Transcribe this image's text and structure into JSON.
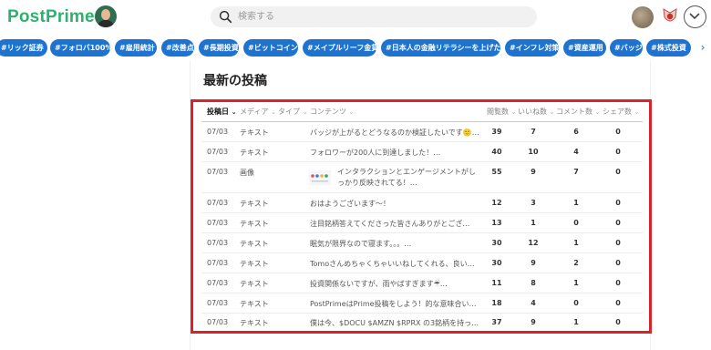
{
  "header": {
    "logo_text": "PostPrime",
    "search": {
      "placeholder": "検索する"
    }
  },
  "tags": [
    "#リック証券",
    "#フォロバ100%",
    "#雇用統計",
    "#改善点",
    "#長期投資",
    "#ビットコイン",
    "#メイプルリーフ金貨",
    "#日本人の金融リテラシーを上げたい",
    "#インフレ対策",
    "#資産運用",
    "#バッジ",
    "#株式投資"
  ],
  "main": {
    "section_title": "最新の投稿",
    "columns": {
      "date": "投稿日",
      "media": "メディア",
      "type": "タイプ",
      "contents": "コンテンツ",
      "views": "閲覧数",
      "likes": "いいね数",
      "comments": "コメント数",
      "shares": "シェア数"
    },
    "rows": [
      {
        "date": "07/03",
        "media": "テキスト",
        "content": "バッジが上がるとどうなるのか検証したいです🙂…",
        "views": "39",
        "likes": "7",
        "comments": "6",
        "shares": "0"
      },
      {
        "date": "07/03",
        "media": "テキスト",
        "content": "フォロワーが200人に到達しました！…",
        "views": "40",
        "likes": "10",
        "comments": "4",
        "shares": "0"
      },
      {
        "date": "07/03",
        "media": "画像",
        "content": "インタラクションとエンゲージメントがし",
        "content2": "っかり反映されてる！…",
        "views": "55",
        "likes": "9",
        "comments": "7",
        "shares": "0"
      },
      {
        "date": "07/03",
        "media": "テキスト",
        "content": "おはようございます〜！",
        "views": "12",
        "likes": "3",
        "comments": "1",
        "shares": "0"
      },
      {
        "date": "07/03",
        "media": "テキスト",
        "content": "注目銘柄答えてくださった皆さんありがとござ…",
        "views": "13",
        "likes": "1",
        "comments": "0",
        "shares": "0"
      },
      {
        "date": "07/03",
        "media": "テキスト",
        "content": "眠気が限界なので寝ます。。。…",
        "views": "30",
        "likes": "12",
        "comments": "1",
        "shares": "0"
      },
      {
        "date": "07/03",
        "media": "テキスト",
        "content": "Tomoさんめちゃくちゃいいねしてくれる、良い…",
        "views": "30",
        "likes": "9",
        "comments": "2",
        "shares": "0"
      },
      {
        "date": "07/03",
        "media": "テキスト",
        "content": "投資関係ないですが、雨やばすぎます☔…",
        "views": "11",
        "likes": "8",
        "comments": "1",
        "shares": "0"
      },
      {
        "date": "07/03",
        "media": "テキスト",
        "content": "PostPrimeはPrime投稿をしよう！的な意味合い…",
        "views": "18",
        "likes": "4",
        "comments": "0",
        "shares": "0"
      },
      {
        "date": "07/03",
        "media": "テキスト",
        "content": "僕は今、$DOCU $AMZN $RPRX の3銘柄を持っ…",
        "views": "37",
        "likes": "9",
        "comments": "1",
        "shares": "0"
      }
    ]
  },
  "colors": {
    "brand": "#2cb26e",
    "tag": "#1f73d0",
    "highlight": "#d9232a"
  }
}
